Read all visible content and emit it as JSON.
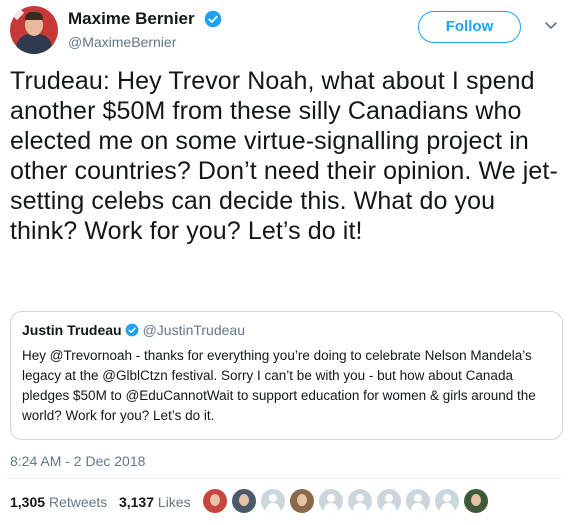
{
  "author": {
    "display_name": "Maxime Bernier",
    "handle": "@MaximeBernier",
    "verified_icon": "verified-badge-icon"
  },
  "actions": {
    "follow_label": "Follow",
    "menu_icon": "chevron-down-icon"
  },
  "tweet": {
    "text": "Trudeau: Hey Trevor Noah, what about I spend another $50M from these silly Canadians who elected me on some virtue-signalling project in other countries? Don’t need their opinion. We jet-setting celebs can decide this. What do you think? Work for you? Let’s do it!",
    "timestamp": "8:24 AM - 2 Dec 2018"
  },
  "quoted_tweet": {
    "display_name": "Justin Trudeau",
    "handle": "@JustinTrudeau",
    "text": "Hey @Trevornoah - thanks for everything you’re doing to celebrate Nelson Mandela’s legacy at the @GlblCtzn festival. Sorry I can’t be with you - but how about Canada pledges $50M to @EduCannotWait to support education for women & girls around the world? Work for you? Let’s do it."
  },
  "stats": {
    "retweets_count": "1,305",
    "retweets_label": "Retweets",
    "likes_count": "3,137",
    "likes_label": "Likes"
  },
  "likers": [
    {
      "kind": "photo",
      "color": "#c8443c"
    },
    {
      "kind": "photo",
      "color": "#4a5a6a"
    },
    {
      "kind": "default"
    },
    {
      "kind": "photo",
      "color": "#8a6a4a"
    },
    {
      "kind": "default"
    },
    {
      "kind": "default"
    },
    {
      "kind": "default"
    },
    {
      "kind": "default"
    },
    {
      "kind": "default"
    },
    {
      "kind": "photo",
      "color": "#3e5a3a"
    }
  ],
  "colors": {
    "accent": "#1da1f2",
    "secondary_text": "#657786",
    "border": "#ccd6dd"
  }
}
